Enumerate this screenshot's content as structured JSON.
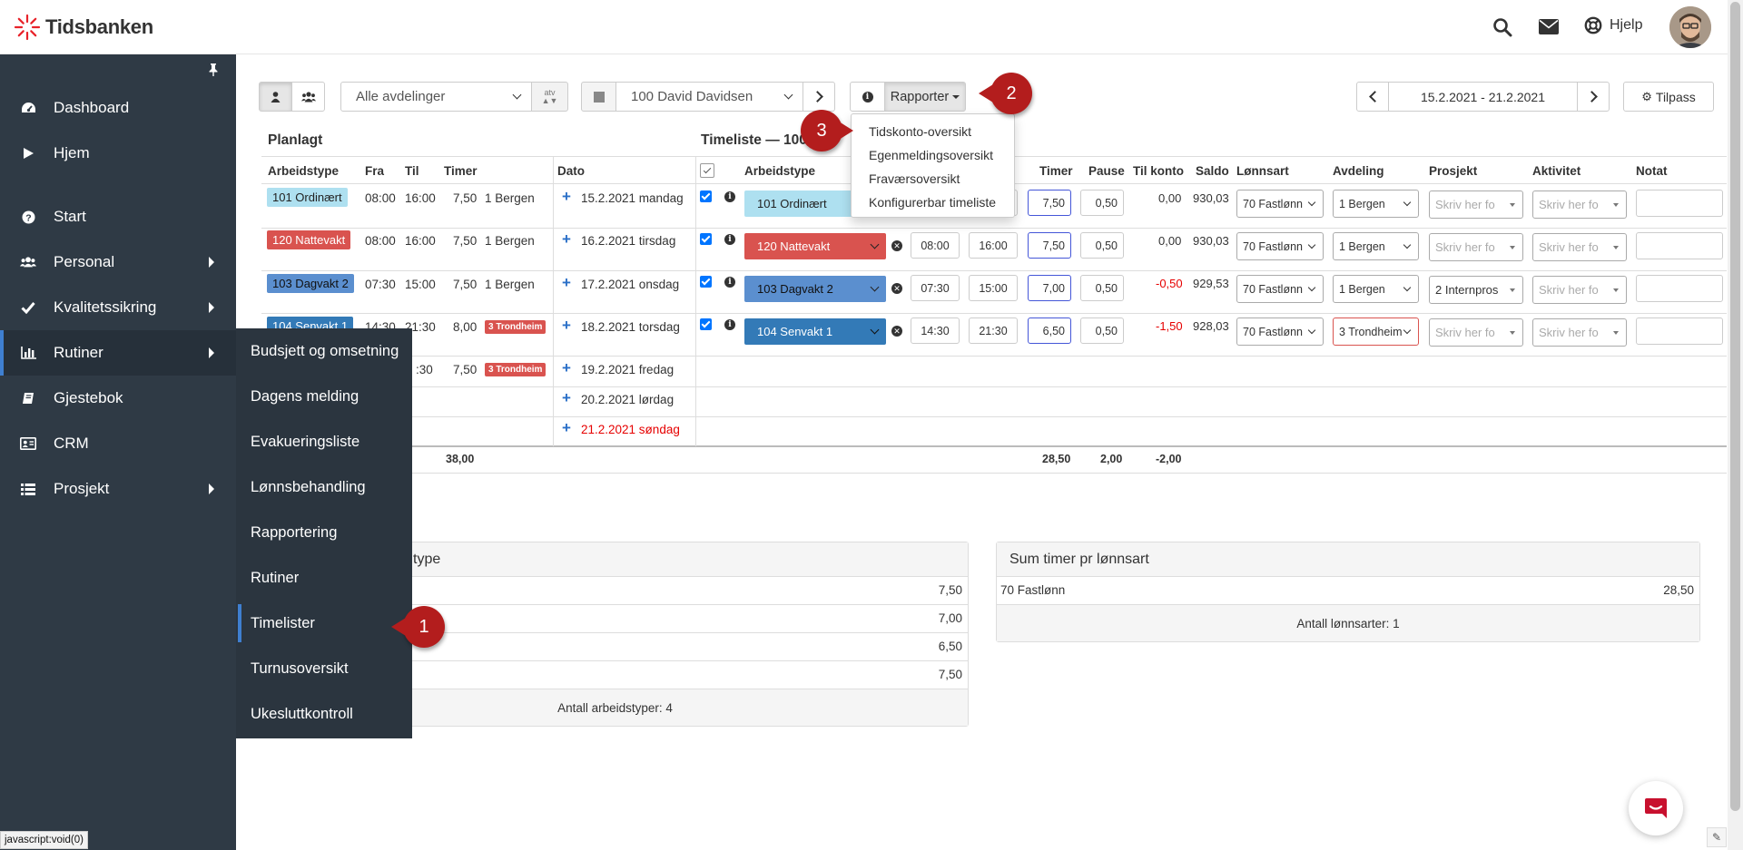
{
  "topbar": {
    "logo_text": "Tidsbanken",
    "help_label": "Hjelp",
    "icons": [
      "search-icon",
      "mail-icon",
      "lifebuoy-icon"
    ]
  },
  "sidebar": {
    "items": [
      {
        "label": "Dashboard",
        "icon": "dashboard-icon"
      },
      {
        "label": "Hjem",
        "icon": "play-icon"
      },
      {
        "label": "Start",
        "icon": "question-icon"
      },
      {
        "label": "Personal",
        "icon": "users-icon"
      },
      {
        "label": "Kvalitetssikring",
        "icon": "check-icon"
      },
      {
        "label": "Rutiner",
        "icon": "bar-chart-icon"
      },
      {
        "label": "Gjestebok",
        "icon": "book-icon"
      },
      {
        "label": "CRM",
        "icon": "contact-card-icon"
      },
      {
        "label": "Prosjekt",
        "icon": "list-icon"
      }
    ]
  },
  "submenu": {
    "items": [
      "Budsjett og omsetning",
      "Dagens melding",
      "Evakueringsliste",
      "Lønnsbehandling",
      "Rapportering",
      "Rutiner",
      "Timelister",
      "Turnusoversikt",
      "Ukesluttkontroll"
    ]
  },
  "toolbar": {
    "department": "Alle avdelinger",
    "atv_label": "atv",
    "employee": "100 David Davidsen",
    "reports_label": "Rapporter",
    "period": "15.2.2021 - 21.2.2021",
    "customize_label": "Tilpass"
  },
  "reports_menu": [
    "Tidskonto-oversikt",
    "Egenmeldingsoversikt",
    "Fraværsoversikt",
    "Konfigurerbar timeliste"
  ],
  "markers": [
    "1",
    "2",
    "3"
  ],
  "planned": {
    "title": "Planlagt",
    "headers": [
      "Arbeidstype",
      "Fra",
      "Til",
      "Timer",
      "Dato"
    ],
    "rows": [
      {
        "type": "101 Ordinært",
        "from": "08:00",
        "to": "16:00",
        "hours": "7,50",
        "dept": "1 Bergen",
        "date": "15.2.2021 mandag"
      },
      {
        "type": "120 Nattevakt",
        "from": "08:00",
        "to": "16:00",
        "hours": "7,50",
        "dept": "1 Bergen",
        "date": "16.2.2021 tirsdag"
      },
      {
        "type": "103 Dagvakt 2",
        "from": "07:30",
        "to": "15:00",
        "hours": "7,50",
        "dept": "1 Bergen",
        "date": "17.2.2021 onsdag"
      },
      {
        "type": "104 Senvakt 1",
        "from": "14:30",
        "to": "21:30",
        "hours": "8,00",
        "dept": "3 Trondheim",
        "date": "18.2.2021 torsdag"
      },
      {
        "type": "",
        "from": "",
        "to": ":30",
        "hours": "7,50",
        "dept": "3 Trondheim",
        "date": "19.2.2021 fredag"
      },
      {
        "date": "20.2.2021 lørdag"
      },
      {
        "date": "21.2.2021 søndag"
      }
    ],
    "total_hours": "38,00"
  },
  "timesheet": {
    "title": "Timeliste — 100 Dav",
    "headers": [
      "Arbeidstype",
      "Timer",
      "Pause",
      "Til konto",
      "Saldo",
      "Lønnsart",
      "Avdeling",
      "Prosjekt",
      "Aktivitet",
      "Notat"
    ],
    "placeholder": "Skriv her fo",
    "rows": [
      {
        "type": "101 Ordinært",
        "from": "",
        "to": "",
        "hours": "7,50",
        "pause": "0,50",
        "account": "0,00",
        "saldo": "930,03",
        "wage": "70 Fastlønn",
        "dept": "1 Bergen",
        "project": ""
      },
      {
        "type": "120 Nattevakt",
        "from": "08:00",
        "to": "16:00",
        "hours": "7,50",
        "pause": "0,50",
        "account": "0,00",
        "saldo": "930,03",
        "wage": "70 Fastlønn",
        "dept": "1 Bergen",
        "project": ""
      },
      {
        "type": "103 Dagvakt 2",
        "from": "07:30",
        "to": "15:00",
        "hours": "7,00",
        "pause": "0,50",
        "account": "-0,50",
        "saldo": "929,53",
        "wage": "70 Fastlønn",
        "dept": "1 Bergen",
        "project": "2 Internpros"
      },
      {
        "type": "104 Senvakt 1",
        "from": "14:30",
        "to": "21:30",
        "hours": "6,50",
        "pause": "0,50",
        "account": "-1,50",
        "saldo": "928,03",
        "wage": "70 Fastlønn",
        "dept": "3 Trondheim",
        "project": ""
      }
    ],
    "totals": {
      "hours": "28,50",
      "pause": "2,00",
      "account": "-2,00"
    }
  },
  "sum_type": {
    "title_suffix": "type",
    "values": [
      "7,50",
      "7,00",
      "6,50",
      "7,50"
    ],
    "footer": "Antall arbeidstyper: 4"
  },
  "sum_wage": {
    "title": "Sum timer pr lønnsart",
    "row_label": "70 Fastlønn",
    "row_value": "28,50",
    "footer": "Antall lønnsarter: 1"
  },
  "status_bar": "javascript:void(0)",
  "colors": {
    "sidebar": "#2f3a45",
    "ordinaert": "#aee0f0",
    "nattevakt": "#d9534f",
    "dagvakt": "#5b8fcf",
    "senvakt": "#337ab7",
    "marker": "#b31d1d"
  }
}
